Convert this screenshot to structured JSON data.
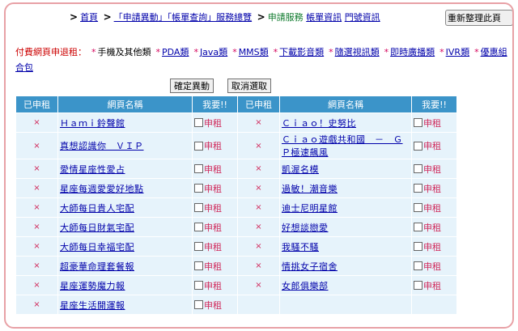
{
  "nav": {
    "home": "首頁",
    "account_service": "「申請異動」「帳單查詢」服務總覽",
    "current": "申請服務",
    "bill_info": "帳單資訊",
    "number_info": "門號資訊"
  },
  "refresh_label": "重新整理此頁",
  "categories": {
    "label": "付費網頁申退租：",
    "items": [
      {
        "label": "手機及其他類",
        "link": false
      },
      {
        "label": "PDA類",
        "link": true
      },
      {
        "label": "Java類",
        "link": true
      },
      {
        "label": "MMS類",
        "link": true
      },
      {
        "label": "下載影音類",
        "link": true
      },
      {
        "label": "隨選視訊類",
        "link": true
      },
      {
        "label": "即時廣播類",
        "link": true
      },
      {
        "label": "IVR類",
        "link": true
      },
      {
        "label": "優惠組合包",
        "link": true
      }
    ]
  },
  "actions": {
    "confirm": "確定異動",
    "cancel": "取消選取"
  },
  "table": {
    "headers": [
      "已申租",
      "網頁名稱",
      "我要!!",
      "已申租",
      "網頁名稱",
      "我要!!"
    ],
    "x_mark": "×",
    "apply_label": "申租",
    "left_rows": [
      "Ｈａｍｉ鈴聲館",
      "真想認識你＿ＶＩＰ",
      "愛情星座性愛占",
      "星座每週愛愛好地點",
      "大師每日貴人宅配",
      "大師每日財氣宅配",
      "大師每日幸福宅配",
      "超豪華命理套餐報",
      "星座運勢魔力報",
      "星座生活開運報"
    ],
    "right_rows": [
      "Ｃｉａｏ！史努比",
      "Ｃｉａｏ遊戲共和國　－　ＧＰ極速飆風",
      "凱渥名模",
      "過敏！潮音樂",
      "迪士尼明星館",
      "好想談戀愛",
      "我騷不騷",
      "情挑女子宿舍",
      "女郎俱樂部"
    ]
  }
}
